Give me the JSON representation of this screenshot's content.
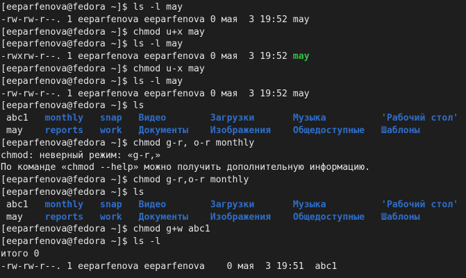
{
  "colors": {
    "background": "#1e1e1e",
    "text": "#e6e6e6",
    "executable": "#33c14a",
    "directory": "#2f6ec9"
  },
  "lines": [
    {
      "segments": [
        {
          "text": "[eeparfenova@fedora ~]$ ls -l may",
          "type": "plain"
        }
      ]
    },
    {
      "segments": [
        {
          "text": "-rw-rw-r--. 1 eeparfenova eeparfenova 0 мая  3 19:52 may",
          "type": "plain"
        }
      ]
    },
    {
      "segments": [
        {
          "text": "[eeparfenova@fedora ~]$ chmod u+x may",
          "type": "plain"
        }
      ]
    },
    {
      "segments": [
        {
          "text": "[eeparfenova@fedora ~]$ ls -l may",
          "type": "plain"
        }
      ]
    },
    {
      "segments": [
        {
          "text": "-rwxrw-r--. 1 eeparfenova eeparfenova 0 мая  3 19:52 ",
          "type": "plain"
        },
        {
          "text": "may",
          "type": "exec"
        }
      ]
    },
    {
      "segments": [
        {
          "text": "[eeparfenova@fedora ~]$ chmod u-x may",
          "type": "plain"
        }
      ]
    },
    {
      "segments": [
        {
          "text": "[eeparfenova@fedora ~]$ ls -l may",
          "type": "plain"
        }
      ]
    },
    {
      "segments": [
        {
          "text": "-rw-rw-r--. 1 eeparfenova eeparfenova 0 мая  3 19:52 may",
          "type": "plain"
        }
      ]
    },
    {
      "segments": [
        {
          "text": "[eeparfenova@fedora ~]$ ls",
          "type": "plain"
        }
      ]
    },
    {
      "segments": [
        {
          "text": " abc1   ",
          "type": "plain"
        },
        {
          "text": "monthly",
          "type": "dir"
        },
        {
          "text": "   ",
          "type": "plain"
        },
        {
          "text": "snap",
          "type": "dir"
        },
        {
          "text": "   ",
          "type": "plain"
        },
        {
          "text": "Видео",
          "type": "dir"
        },
        {
          "text": "        ",
          "type": "plain"
        },
        {
          "text": "Загрузки",
          "type": "dir"
        },
        {
          "text": "       ",
          "type": "plain"
        },
        {
          "text": "Музыка",
          "type": "dir"
        },
        {
          "text": "          ",
          "type": "plain"
        },
        {
          "text": "'Рабочий стол'",
          "type": "dir"
        }
      ]
    },
    {
      "segments": [
        {
          "text": " may    ",
          "type": "plain"
        },
        {
          "text": "reports",
          "type": "dir"
        },
        {
          "text": "   ",
          "type": "plain"
        },
        {
          "text": "work",
          "type": "dir"
        },
        {
          "text": "   ",
          "type": "plain"
        },
        {
          "text": "Документы",
          "type": "dir"
        },
        {
          "text": "    ",
          "type": "plain"
        },
        {
          "text": "Изображения",
          "type": "dir"
        },
        {
          "text": "    ",
          "type": "plain"
        },
        {
          "text": "Общедоступные",
          "type": "dir"
        },
        {
          "text": "   ",
          "type": "plain"
        },
        {
          "text": "Шаблоны",
          "type": "dir"
        }
      ]
    },
    {
      "segments": [
        {
          "text": "[eeparfenova@fedora ~]$ chmod g-r, o-r monthly",
          "type": "plain"
        }
      ]
    },
    {
      "segments": [
        {
          "text": "chmod: неверный режим: «g-r,»",
          "type": "plain"
        }
      ]
    },
    {
      "segments": [
        {
          "text": "По команде «chmod --help» можно получить дополнительную информацию.",
          "type": "plain"
        }
      ]
    },
    {
      "segments": [
        {
          "text": "[eeparfenova@fedora ~]$ chmod g-r,o-r monthly",
          "type": "plain"
        }
      ]
    },
    {
      "segments": [
        {
          "text": "[eeparfenova@fedora ~]$ ls",
          "type": "plain"
        }
      ]
    },
    {
      "segments": [
        {
          "text": " abc1   ",
          "type": "plain"
        },
        {
          "text": "monthly",
          "type": "dir"
        },
        {
          "text": "   ",
          "type": "plain"
        },
        {
          "text": "snap",
          "type": "dir"
        },
        {
          "text": "   ",
          "type": "plain"
        },
        {
          "text": "Видео",
          "type": "dir"
        },
        {
          "text": "        ",
          "type": "plain"
        },
        {
          "text": "Загрузки",
          "type": "dir"
        },
        {
          "text": "       ",
          "type": "plain"
        },
        {
          "text": "Музыка",
          "type": "dir"
        },
        {
          "text": "          ",
          "type": "plain"
        },
        {
          "text": "'Рабочий стол'",
          "type": "dir"
        }
      ]
    },
    {
      "segments": [
        {
          "text": " may    ",
          "type": "plain"
        },
        {
          "text": "reports",
          "type": "dir"
        },
        {
          "text": "   ",
          "type": "plain"
        },
        {
          "text": "work",
          "type": "dir"
        },
        {
          "text": "   ",
          "type": "plain"
        },
        {
          "text": "Документы",
          "type": "dir"
        },
        {
          "text": "    ",
          "type": "plain"
        },
        {
          "text": "Изображения",
          "type": "dir"
        },
        {
          "text": "    ",
          "type": "plain"
        },
        {
          "text": "Общедоступные",
          "type": "dir"
        },
        {
          "text": "   ",
          "type": "plain"
        },
        {
          "text": "Шаблоны",
          "type": "dir"
        }
      ]
    },
    {
      "segments": [
        {
          "text": "[eeparfenova@fedora ~]$ chmod g+w abc1",
          "type": "plain"
        }
      ]
    },
    {
      "segments": [
        {
          "text": "[eeparfenova@fedora ~]$ ls -l",
          "type": "plain"
        }
      ]
    },
    {
      "segments": [
        {
          "text": "итого 0",
          "type": "plain"
        }
      ]
    },
    {
      "segments": [
        {
          "text": "-rw-rw-r--. 1 eeparfenova eeparfenova    0 мая  3 19:51  abc1",
          "type": "plain"
        }
      ]
    }
  ]
}
